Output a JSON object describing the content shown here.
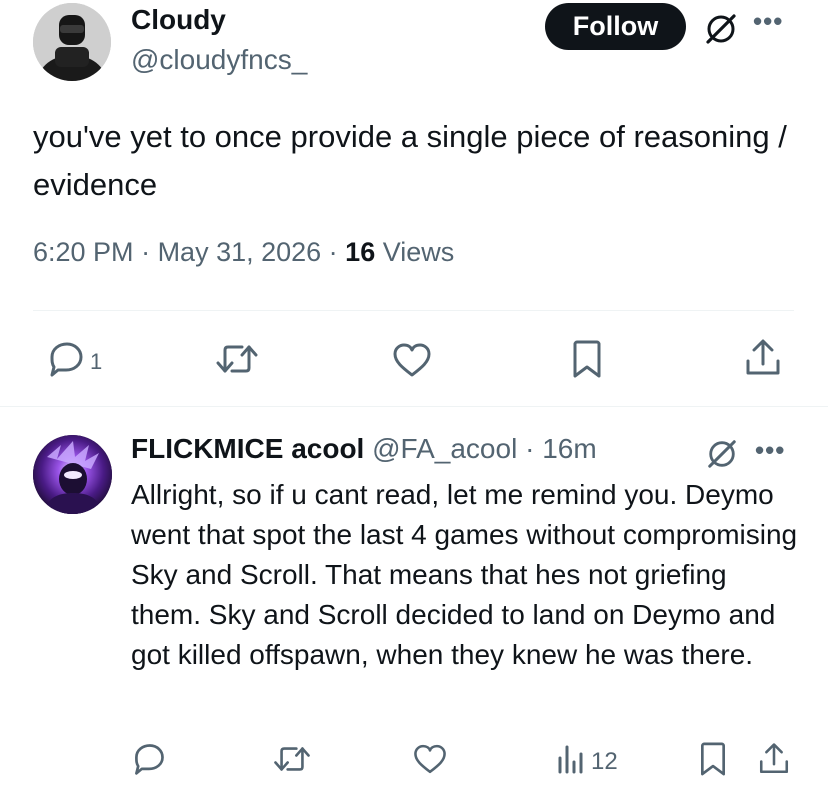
{
  "main_tweet": {
    "author_name": "Cloudy",
    "author_handle": "@cloudyfncs_",
    "follow_label": "Follow",
    "text": "you've yet to once provide a single piece of reasoning / evidence",
    "time": "6:20 PM",
    "sep1": " · ",
    "date": "May 31, 2026",
    "sep2": " · ",
    "views_count": "16",
    "views_label": "Views",
    "actions": {
      "reply_count": "1"
    }
  },
  "reply_tweet": {
    "author_name": "FLICKMICE acool",
    "author_handle": "@FA_acool",
    "sep": " · ",
    "time_ago": "16m",
    "text": "Allright, so if u cant read, let me remind you. Deymo went that spot the last 4 games without compromising Sky and Scroll. That means that hes not griefing them. Sky and Scroll decided to land on Deymo and got killed offspawn, when they knew he was there.",
    "actions": {
      "views_count": "12"
    }
  },
  "icons": {
    "grok": "grok-icon",
    "more": "more-icon",
    "reply": "reply-icon",
    "retweet": "retweet-icon",
    "like": "heart-icon",
    "bookmark": "bookmark-icon",
    "share": "share-icon",
    "views": "views-icon"
  },
  "colors": {
    "text_primary": "#0f1419",
    "text_secondary": "#536471",
    "follow_bg": "#0f1419",
    "divider": "#eff3f4"
  }
}
